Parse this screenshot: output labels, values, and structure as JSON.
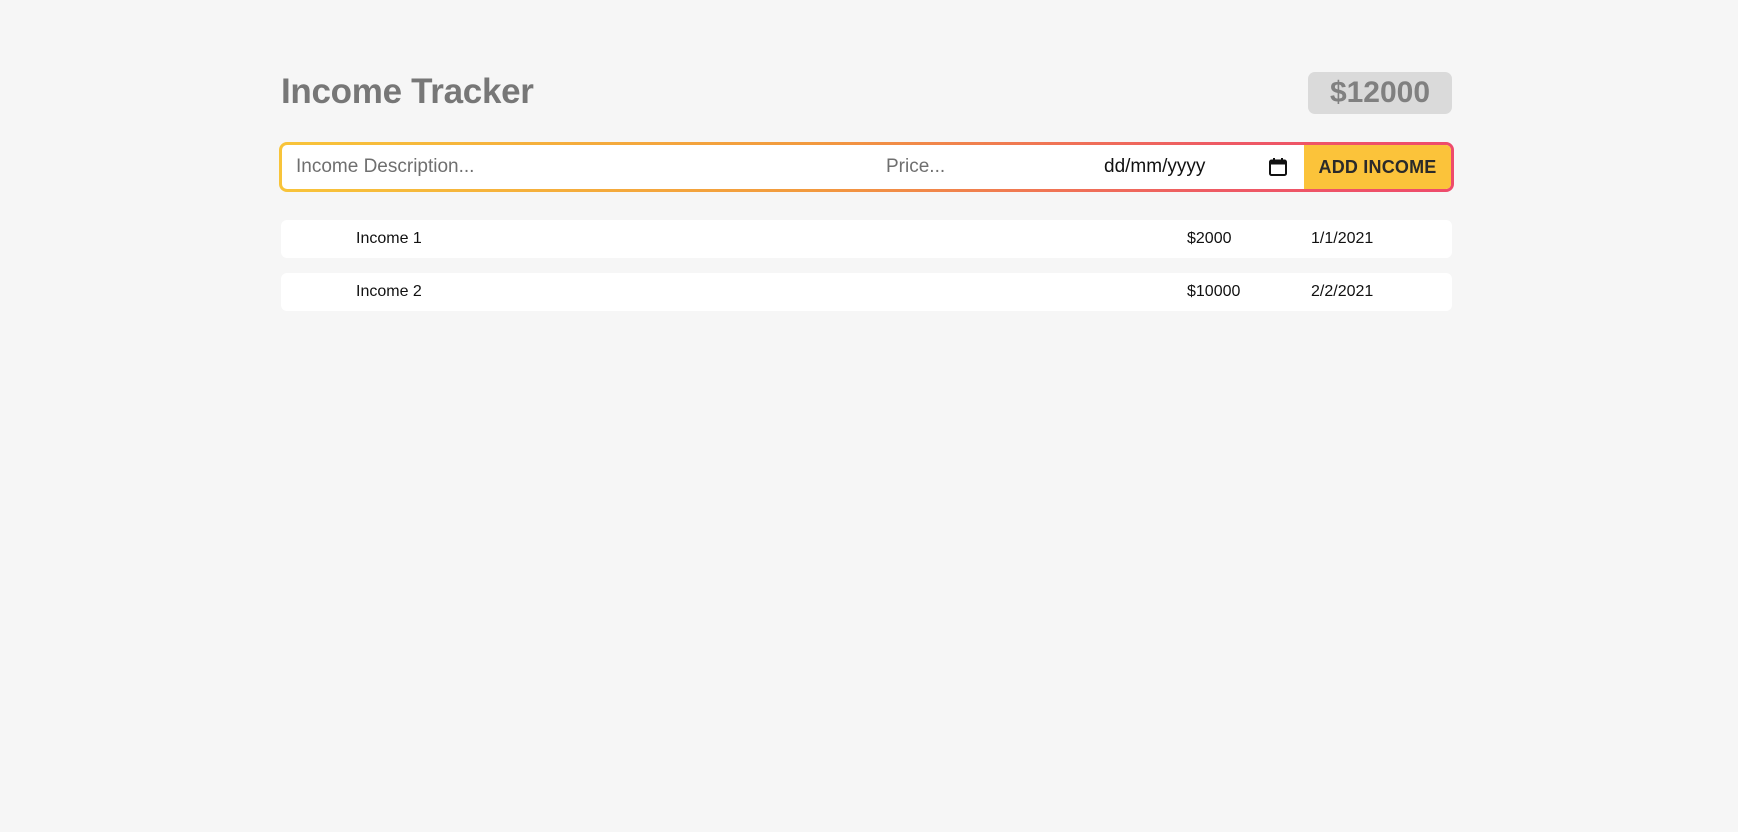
{
  "header": {
    "title": "Income Tracker",
    "total": "$12000"
  },
  "form": {
    "description_placeholder": "Income Description...",
    "price_placeholder": "Price...",
    "date_placeholder": "dd/mm/yyyy",
    "submit_label": "ADD INCOME"
  },
  "incomes": [
    {
      "description": "Income 1",
      "price": "$2000",
      "date": "1/1/2021"
    },
    {
      "description": "Income 2",
      "price": "$10000",
      "date": "2/2/2021"
    }
  ],
  "colors": {
    "background": "#f6f6f6",
    "accent_yellow": "#fbc33a",
    "accent_pink": "#ee4b6c",
    "total_badge": "#dadada",
    "title_text": "#777777"
  },
  "icons": {
    "date_picker": "calendar-icon"
  }
}
